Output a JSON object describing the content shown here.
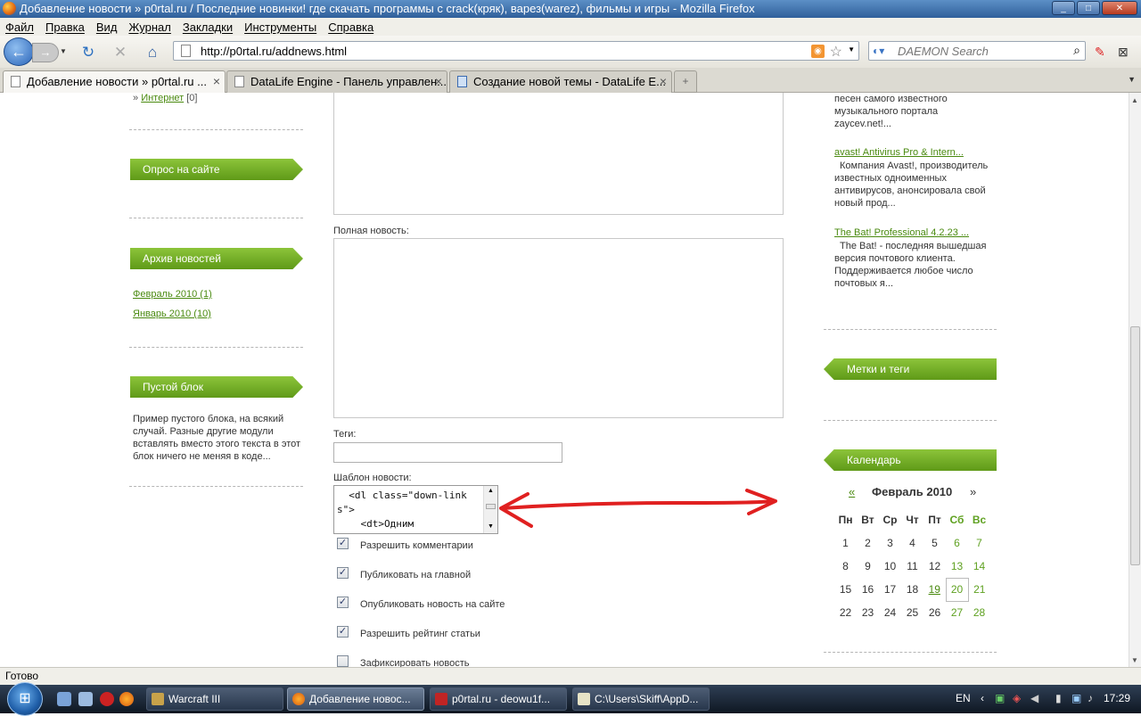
{
  "window": {
    "title": "Добавление новости » p0rtal.ru / Последние новинки! где скачать программы с crack(кряк), варез(warez), фильмы и игры - Mozilla Firefox",
    "controls": [
      "_",
      "□",
      "✕"
    ]
  },
  "menu": [
    "Файл",
    "Правка",
    "Вид",
    "Журнал",
    "Закладки",
    "Инструменты",
    "Справка"
  ],
  "nav": {
    "url": "http://p0rtal.ru/addnews.html",
    "search_placeholder": "DAEMON Search"
  },
  "tabs": [
    {
      "label": "Добавление новости » p0rtal.ru ..."
    },
    {
      "label": "DataLife Engine - Панель управлен..."
    },
    {
      "label": "Создание новой темы - DataLife E..."
    }
  ],
  "left": {
    "category_link": "Интернет",
    "category_prefix": "»",
    "category_count": "[0]",
    "poll_title": "Опрос на сайте",
    "archive_title": "Архив новостей",
    "archive_links": [
      "Февраль 2010 (1)",
      "Январь 2010 (10)"
    ],
    "empty_title": "Пустой блок",
    "empty_text": "Пример пустого блока, на всякий случай. Разные другие модули вставлять вместо этого текста в этот блок ничего не меняя в коде..."
  },
  "form": {
    "full_news_label": "Полная новость:",
    "tags_label": "Теги:",
    "template_label": "Шаблон новости:",
    "template_value": "  <dl class=\"down-links\">\n    <dt>Одним ",
    "checkboxes": [
      {
        "label": "Разрешить комментарии",
        "checked": true
      },
      {
        "label": "Публиковать на главной",
        "checked": true
      },
      {
        "label": "Опубликовать новость на сайте",
        "checked": true
      },
      {
        "label": "Разрешить рейтинг статьи",
        "checked": true
      },
      {
        "label": "Зафиксировать новость",
        "checked": false
      }
    ]
  },
  "right": {
    "top_snippet": "песен самого известного музыкального портала zaycev.net!...",
    "news": [
      {
        "title": "avast! Antivirus Pro & Intern...",
        "text": "Компания Avast!, производитель известных одноименных антивирусов, анонсировала свой новый прод..."
      },
      {
        "title": "The Bat! Professional 4.2.23 ...",
        "text": "The Bat! - последняя вышедшая версия почтового клиента. Поддерживается любое число почтовых я..."
      }
    ],
    "tags_title": "Метки и теги",
    "calendar_title": "Календарь",
    "calendar": {
      "prev": "«",
      "month": "Февраль 2010",
      "next": "»",
      "days": [
        "Пн",
        "Вт",
        "Ср",
        "Чт",
        "Пт",
        "Сб",
        "Вс"
      ],
      "weeks": [
        [
          "1",
          "2",
          "3",
          "4",
          "5",
          "6",
          "7"
        ],
        [
          "8",
          "9",
          "10",
          "11",
          "12",
          "13",
          "14"
        ],
        [
          "15",
          "16",
          "17",
          "18",
          "19",
          "20",
          "21"
        ],
        [
          "22",
          "23",
          "24",
          "25",
          "26",
          "27",
          "28"
        ]
      ],
      "linked_day": "19",
      "today": "20"
    }
  },
  "status": "Готово",
  "taskbar": {
    "tasks": [
      "Warcraft III",
      "Добавление новос...",
      "p0rtal.ru - deowu1f...",
      "C:\\Users\\Skiff\\AppD..."
    ],
    "lang": "EN",
    "time": "17:29"
  },
  "colors": {
    "accent": "#6aa821",
    "link": "#4a8a10",
    "arrow": "#e02020"
  }
}
